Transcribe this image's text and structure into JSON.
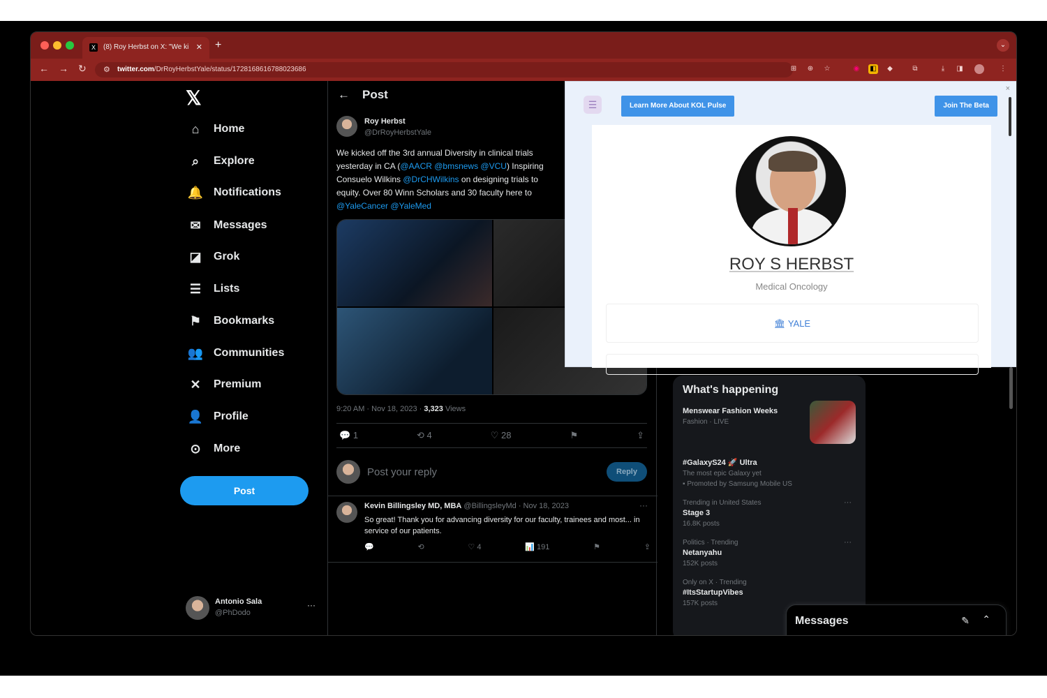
{
  "browser": {
    "tab_title": "(8) Roy Herbst on X: \"We ki",
    "tab_favicon": "X",
    "url_host": "twitter.com",
    "url_path": "/DrRoyHerbstYale/status/1728168616788023686",
    "new_tab": "+"
  },
  "nav": {
    "logo": "𝕏",
    "items": [
      {
        "icon": "⌂",
        "label": "Home"
      },
      {
        "icon": "⌕",
        "label": "Explore"
      },
      {
        "icon": "🔔",
        "label": "Notifications"
      },
      {
        "icon": "✉",
        "label": "Messages"
      },
      {
        "icon": "◪",
        "label": "Grok"
      },
      {
        "icon": "☰",
        "label": "Lists"
      },
      {
        "icon": "⚑",
        "label": "Bookmarks"
      },
      {
        "icon": "👥",
        "label": "Communities"
      },
      {
        "icon": "✕",
        "label": "Premium"
      },
      {
        "icon": "👤",
        "label": "Profile"
      },
      {
        "icon": "⊙",
        "label": "More"
      }
    ],
    "post_button": "Post",
    "account_name": "Antonio Sala",
    "account_handle": "@PhDodo",
    "account_more": "···"
  },
  "post": {
    "header": "Post",
    "back": "←",
    "author_name": "Roy Herbst",
    "author_handle": "@DrRoyHerbstYale",
    "text_1": "We kicked off the 3rd annual Diversity in clinical trials",
    "text_2": "yesterday in CA (",
    "text_2_link": "@AACR @bmsnews @VCU",
    "text_2_end": ") Inspiring",
    "text_3_a": "Consuelo Wilkins ",
    "text_3_link": "@DrCHWilkins",
    "text_3_end": " on designing trials to",
    "text_4": "equity. Over 80 Winn Scholars and 30 faculty here to",
    "text_5_link": "@YaleCancer @YaleMed",
    "meta_time": "9:20 AM · Nov 18, 2023 · ",
    "meta_views_count": "3,323",
    "meta_views_label": " Views",
    "actions": {
      "reply": "1",
      "repost": "4",
      "like": "28"
    },
    "reply_placeholder": "Post your reply",
    "reply_button": "Reply"
  },
  "comment": {
    "name": "Kevin Billingsley MD, MBA",
    "handle_date": " @BillingsleyMd · Nov 18, 2023",
    "more": "···",
    "text": "So great!  Thank you for advancing diversity for our faculty, trainees and most... in service of our patients.",
    "like_count": "4",
    "views_count": "191"
  },
  "sidebar": {
    "title": "What's happening",
    "trends": [
      {
        "title": "Menswear Fashion Weeks",
        "meta": "Fashion · LIVE"
      },
      {
        "title": "#GalaxyS24 🚀 Ultra",
        "meta": "The most epic Galaxy yet",
        "sub": "Promoted by Samsung Mobile US"
      },
      {
        "context": "Trending in United States",
        "title": "Stage 3",
        "meta": "16.8K posts"
      },
      {
        "context": "Politics · Trending",
        "title": "Netanyahu",
        "meta": "152K posts"
      },
      {
        "context": "Only on X · Trending",
        "title": "#ItsStartupVibes",
        "meta": "157K posts"
      }
    ]
  },
  "messages_dock": {
    "title": "Messages"
  },
  "popup": {
    "learn_button": "Learn More About KOL Pulse",
    "join_button": "Join The Beta",
    "close": "×",
    "menu_icon": "☰",
    "doctor_name": "ROY S HERBST",
    "specialty": "Medical Oncology",
    "institution_icon": "🏛",
    "institution": "YALE"
  },
  "colors": {
    "chrome": "#7a1d1a",
    "accent": "#1d9bf0",
    "popup_button": "#3f93e8"
  }
}
